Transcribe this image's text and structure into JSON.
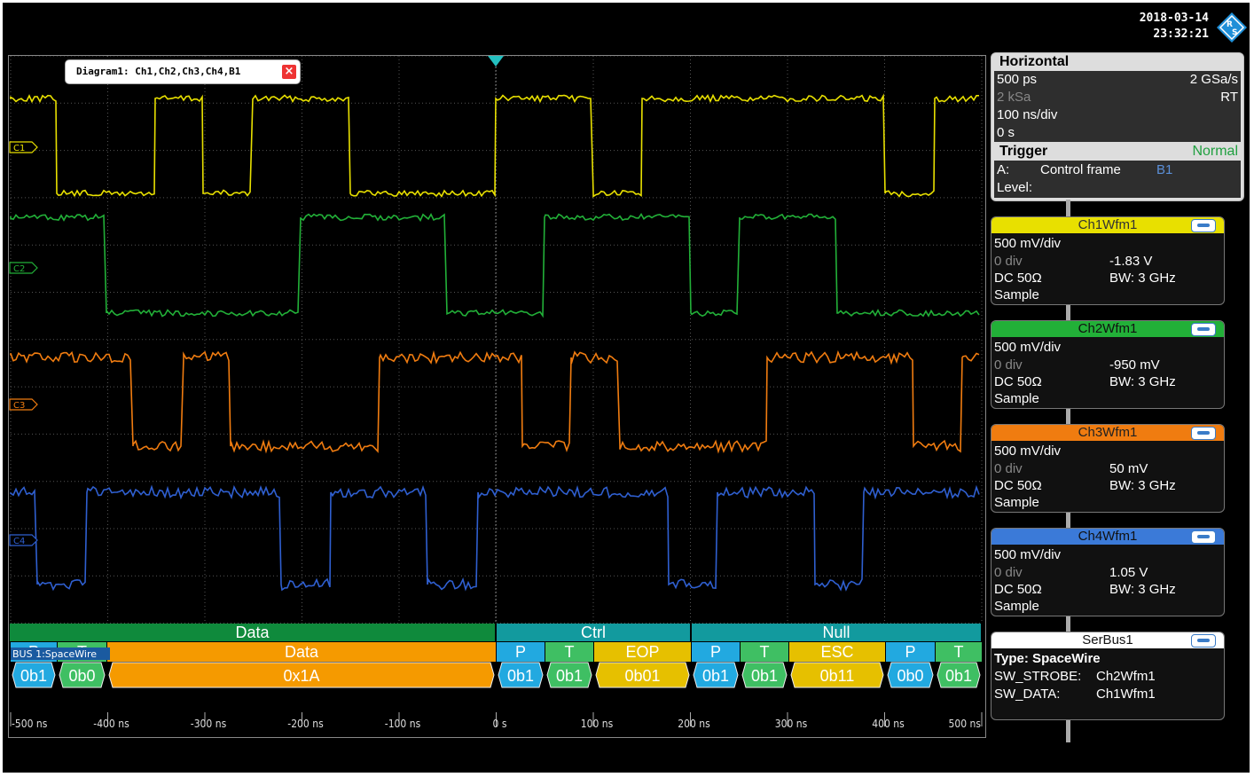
{
  "header": {
    "date": "2018-03-14",
    "time": "23:32:21"
  },
  "diagram": {
    "title": "Diagram1: Ch1,Ch2,Ch3,Ch4,B1"
  },
  "channel_markers": [
    "C1",
    "C2",
    "C3",
    "C4"
  ],
  "colors": {
    "ch1": "#e8e000",
    "ch2": "#22b038",
    "ch3": "#f07c10",
    "ch4": "#2f5fd0",
    "bus_green": "#0f8a3c",
    "bus_teal": "#129a9e",
    "bus_orange": "#f59a00",
    "bus_cyan": "#22a9e0",
    "bus_yellow": "#e6c000",
    "bus_lime": "#3fbf63"
  },
  "bus": {
    "label": "BUS 1:SpaceWire",
    "groups": [
      {
        "label": "Data"
      },
      {
        "label": "Ctrl"
      },
      {
        "label": "Null"
      }
    ],
    "fields": [
      {
        "top": "P",
        "value": "0b1"
      },
      {
        "top": "T",
        "value": "0b0"
      },
      {
        "top": "Data",
        "value": "0x1A"
      },
      {
        "top": "P",
        "value": "0b1"
      },
      {
        "top": "T",
        "value": "0b1"
      },
      {
        "top": "EOP",
        "value": "0b01"
      },
      {
        "top": "P",
        "value": "0b1"
      },
      {
        "top": "T",
        "value": "0b1"
      },
      {
        "top": "ESC",
        "value": "0b11"
      },
      {
        "top": "P",
        "value": "0b0"
      },
      {
        "top": "T",
        "value": "0b1"
      }
    ]
  },
  "time_axis": [
    "-500 ns",
    "-400 ns",
    "-300 ns",
    "-200 ns",
    "-100 ns",
    "0 s",
    "100 ns",
    "200 ns",
    "300 ns",
    "400 ns",
    "500 ns"
  ],
  "horizontal": {
    "title": "Horizontal",
    "resolution": "500 ps",
    "sample_rate": "2 GSa/s",
    "record_length": "2 kSa",
    "mode": "RT",
    "time_scale": "100 ns/div",
    "position": "0 s",
    "trigger_title": "Trigger",
    "trigger_mode": "Normal",
    "trigger_a_label": "A:",
    "trigger_a_value": "Control frame",
    "trigger_source": "B1",
    "level_label": "Level:"
  },
  "channels": [
    {
      "name": "Ch1Wfm1",
      "scale": "500 mV/div",
      "offset_div": "0 div",
      "offset": "-1.83 V",
      "coupling": "DC 50Ω",
      "bandwidth": "BW: 3 GHz",
      "acq": "Sample"
    },
    {
      "name": "Ch2Wfm1",
      "scale": "500 mV/div",
      "offset_div": "0 div",
      "offset": "-950 mV",
      "coupling": "DC 50Ω",
      "bandwidth": "BW: 3 GHz",
      "acq": "Sample"
    },
    {
      "name": "Ch3Wfm1",
      "scale": "500 mV/div",
      "offset_div": "0 div",
      "offset": "50 mV",
      "coupling": "DC 50Ω",
      "bandwidth": "BW: 3 GHz",
      "acq": "Sample"
    },
    {
      "name": "Ch4Wfm1",
      "scale": "500 mV/div",
      "offset_div": "0 div",
      "offset": "1.05 V",
      "coupling": "DC 50Ω",
      "bandwidth": "BW: 3 GHz",
      "acq": "Sample"
    }
  ],
  "serbus": {
    "name": "SerBus1",
    "type": "Type: SpaceWire",
    "strobe_label": "SW_STROBE:",
    "strobe": "Ch2Wfm1",
    "data_label": "SW_DATA:",
    "data": "Ch1Wfm1"
  }
}
